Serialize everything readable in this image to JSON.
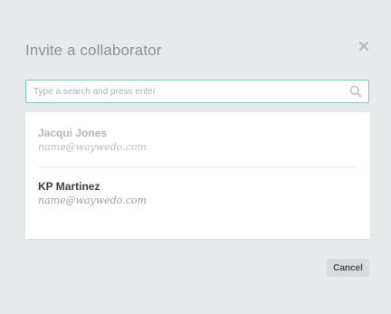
{
  "dialog": {
    "title": "Invite a collaborator",
    "close_icon": "close-icon"
  },
  "search": {
    "placeholder": "Type a search and press enter",
    "value": "",
    "icon": "search-icon",
    "border_color": "#7fc7c8"
  },
  "results": [
    {
      "name": "Jacqui Jones",
      "email": "name@waywedo.com",
      "state": "dimmed"
    },
    {
      "name": "KP Martinez",
      "email": "name@waywedo.com",
      "state": "normal"
    }
  ],
  "footer": {
    "cancel_label": "Cancel"
  }
}
